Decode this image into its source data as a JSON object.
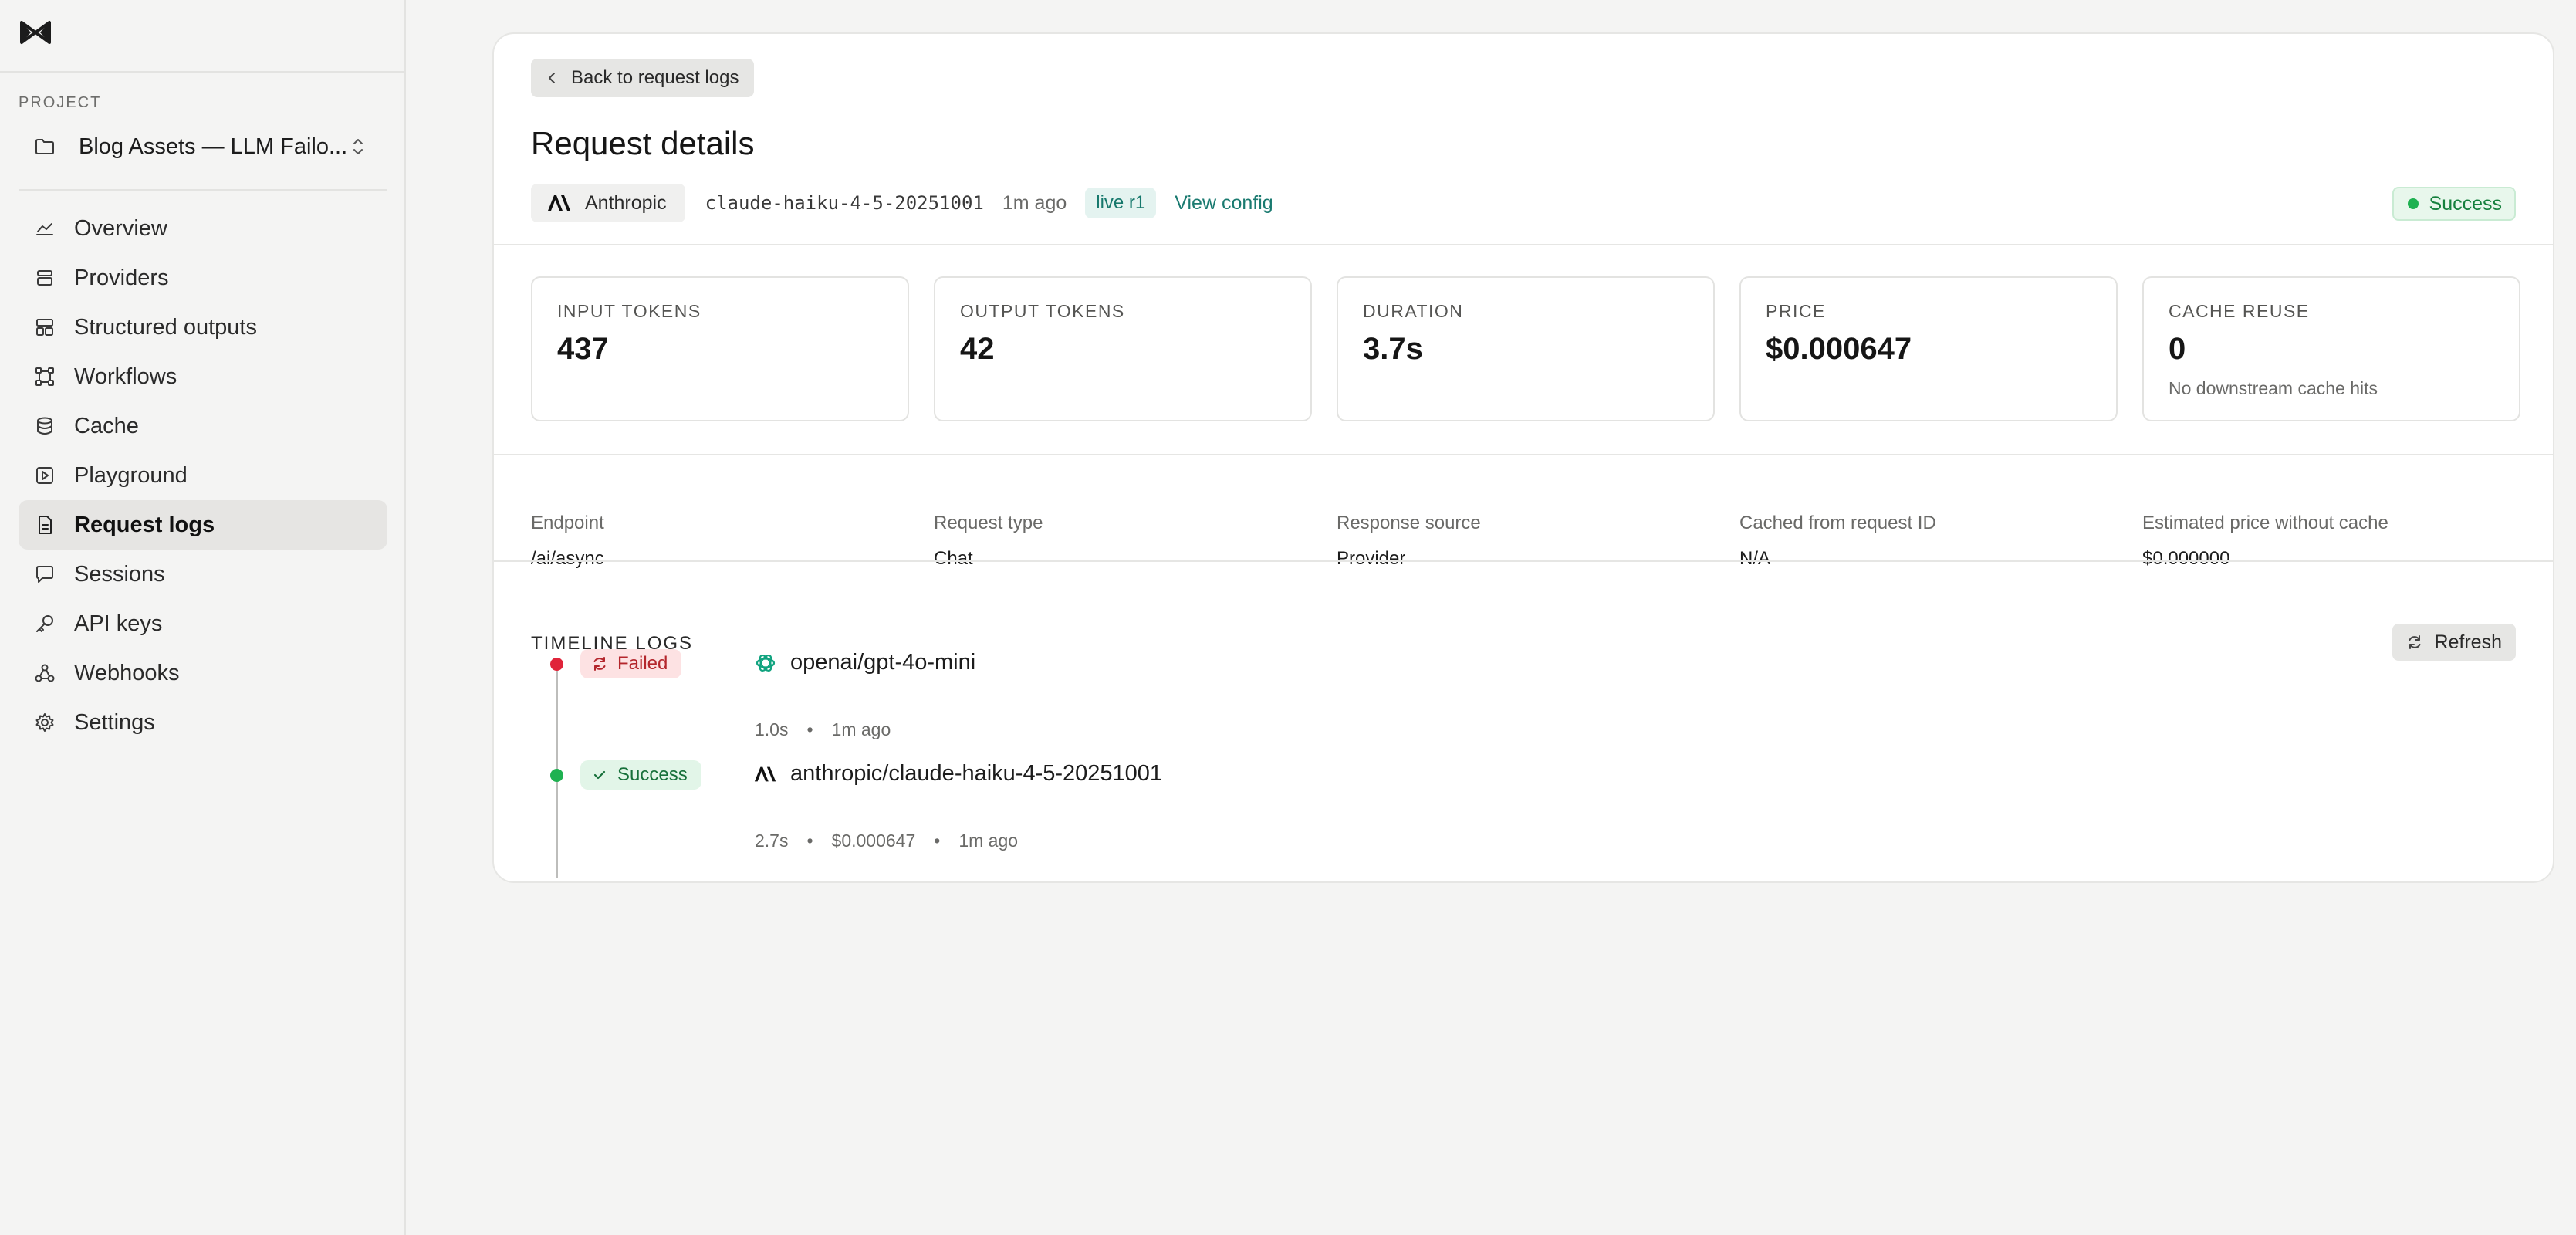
{
  "sidebar": {
    "project_label": "PROJECT",
    "project_name": "Blog Assets — LLM Failo...",
    "items": [
      {
        "label": "Overview",
        "icon": "chart-line-icon"
      },
      {
        "label": "Providers",
        "icon": "stack-icon"
      },
      {
        "label": "Structured outputs",
        "icon": "layout-icon"
      },
      {
        "label": "Workflows",
        "icon": "workflow-icon"
      },
      {
        "label": "Cache",
        "icon": "database-icon"
      },
      {
        "label": "Playground",
        "icon": "play-icon"
      },
      {
        "label": "Request logs",
        "icon": "document-icon",
        "active": true
      },
      {
        "label": "Sessions",
        "icon": "chat-icon"
      },
      {
        "label": "API keys",
        "icon": "key-icon"
      },
      {
        "label": "Webhooks",
        "icon": "webhook-icon"
      },
      {
        "label": "Settings",
        "icon": "gear-icon"
      }
    ]
  },
  "header": {
    "back_label": "Back to request logs",
    "title": "Request details",
    "provider": "Anthropic",
    "model": "claude-haiku-4-5-20251001",
    "ago": "1m ago",
    "live_tag": "live r1",
    "view_config": "View config",
    "status": "Success"
  },
  "stats": [
    {
      "label": "INPUT TOKENS",
      "value": "437",
      "sub": ""
    },
    {
      "label": "OUTPUT TOKENS",
      "value": "42",
      "sub": ""
    },
    {
      "label": "DURATION",
      "value": "3.7s",
      "sub": ""
    },
    {
      "label": "PRICE",
      "value": "$0.000647",
      "sub": ""
    },
    {
      "label": "CACHE REUSE",
      "value": "0",
      "sub": "No downstream cache hits"
    }
  ],
  "properties": [
    {
      "label": "Endpoint",
      "value": "/ai/async"
    },
    {
      "label": "Request type",
      "value": "Chat"
    },
    {
      "label": "Response source",
      "value": "Provider"
    },
    {
      "label": "Cached from request ID",
      "value": "N/A"
    },
    {
      "label": "Estimated price without cache",
      "value": "$0.000000"
    }
  ],
  "timeline": {
    "title": "TIMELINE LOGS",
    "refresh_label": "Refresh",
    "entries": [
      {
        "status": "Failed",
        "model": "openai/gpt-4o-mini",
        "duration": "1.0s",
        "price": "",
        "ago": "1m ago"
      },
      {
        "status": "Success",
        "model": "anthropic/claude-haiku-4-5-20251001",
        "duration": "2.7s",
        "price": "$0.000647",
        "ago": "1m ago"
      }
    ]
  },
  "colors": {
    "accent_teal": "#1a7a70",
    "success": "#1fb151",
    "failure": "#e0243a"
  }
}
